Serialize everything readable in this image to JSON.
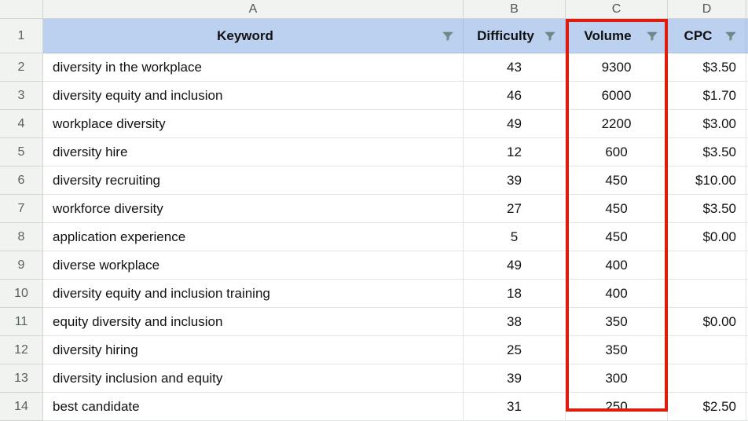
{
  "columns": {
    "A": "A",
    "B": "B",
    "C": "C",
    "D": "D"
  },
  "headers": {
    "keyword": "Keyword",
    "difficulty": "Difficulty",
    "volume": "Volume",
    "cpc": "CPC"
  },
  "row_numbers": [
    "1",
    "2",
    "3",
    "4",
    "5",
    "6",
    "7",
    "8",
    "9",
    "10",
    "11",
    "12",
    "13",
    "14"
  ],
  "rows": [
    {
      "keyword": "diversity in the workplace",
      "difficulty": "43",
      "volume": "9300",
      "cpc": "$3.50"
    },
    {
      "keyword": "diversity equity and inclusion",
      "difficulty": "46",
      "volume": "6000",
      "cpc": "$1.70"
    },
    {
      "keyword": "workplace diversity",
      "difficulty": "49",
      "volume": "2200",
      "cpc": "$3.00"
    },
    {
      "keyword": "diversity hire",
      "difficulty": "12",
      "volume": "600",
      "cpc": "$3.50"
    },
    {
      "keyword": "diversity recruiting",
      "difficulty": "39",
      "volume": "450",
      "cpc": "$10.00"
    },
    {
      "keyword": "workforce diversity",
      "difficulty": "27",
      "volume": "450",
      "cpc": "$3.50"
    },
    {
      "keyword": "application experience",
      "difficulty": "5",
      "volume": "450",
      "cpc": "$0.00"
    },
    {
      "keyword": "diverse workplace",
      "difficulty": "49",
      "volume": "400",
      "cpc": ""
    },
    {
      "keyword": "diversity equity and inclusion training",
      "difficulty": "18",
      "volume": "400",
      "cpc": ""
    },
    {
      "keyword": "equity diversity and inclusion",
      "difficulty": "38",
      "volume": "350",
      "cpc": "$0.00"
    },
    {
      "keyword": "diversity hiring",
      "difficulty": "25",
      "volume": "350",
      "cpc": ""
    },
    {
      "keyword": "diversity inclusion and equity",
      "difficulty": "39",
      "volume": "300",
      "cpc": ""
    },
    {
      "keyword": "best candidate",
      "difficulty": "31",
      "volume": "250",
      "cpc": "$2.50"
    }
  ],
  "highlight": {
    "column": "C"
  }
}
